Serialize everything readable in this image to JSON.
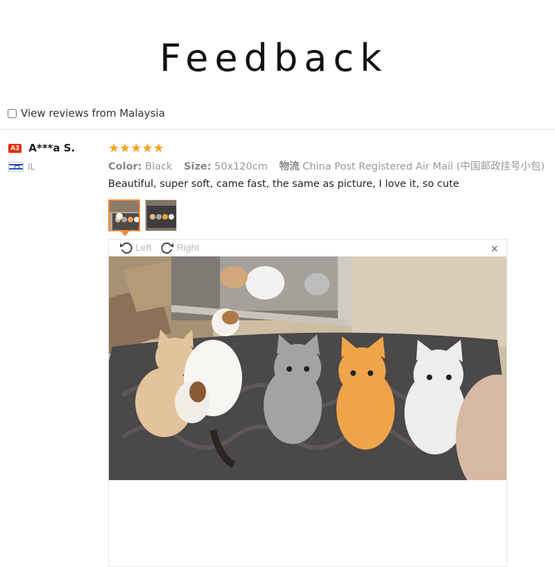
{
  "header": {
    "title": "Feedback"
  },
  "filter": {
    "label": "View reviews from Malaysia",
    "checked": false
  },
  "reviewer": {
    "badge": "A3",
    "name": "A***a S.",
    "country": "IL"
  },
  "review": {
    "rating": 5,
    "color_label": "Color:",
    "color_value": "Black",
    "size_label": "Size:",
    "size_value": "50x120cm",
    "shipping_label": "物流",
    "shipping_value": "China Post Registered Air Mail (中国邮政挂号小包)",
    "text": "Beautiful, super soft, came fast, the same as picture, I love it, so cute"
  },
  "viewer": {
    "rotate_left": "Left",
    "rotate_right": "Right",
    "close": "×"
  },
  "colors": {
    "accent": "#f08a3a",
    "star": "#f8a11f",
    "badge": "#e62e04"
  }
}
